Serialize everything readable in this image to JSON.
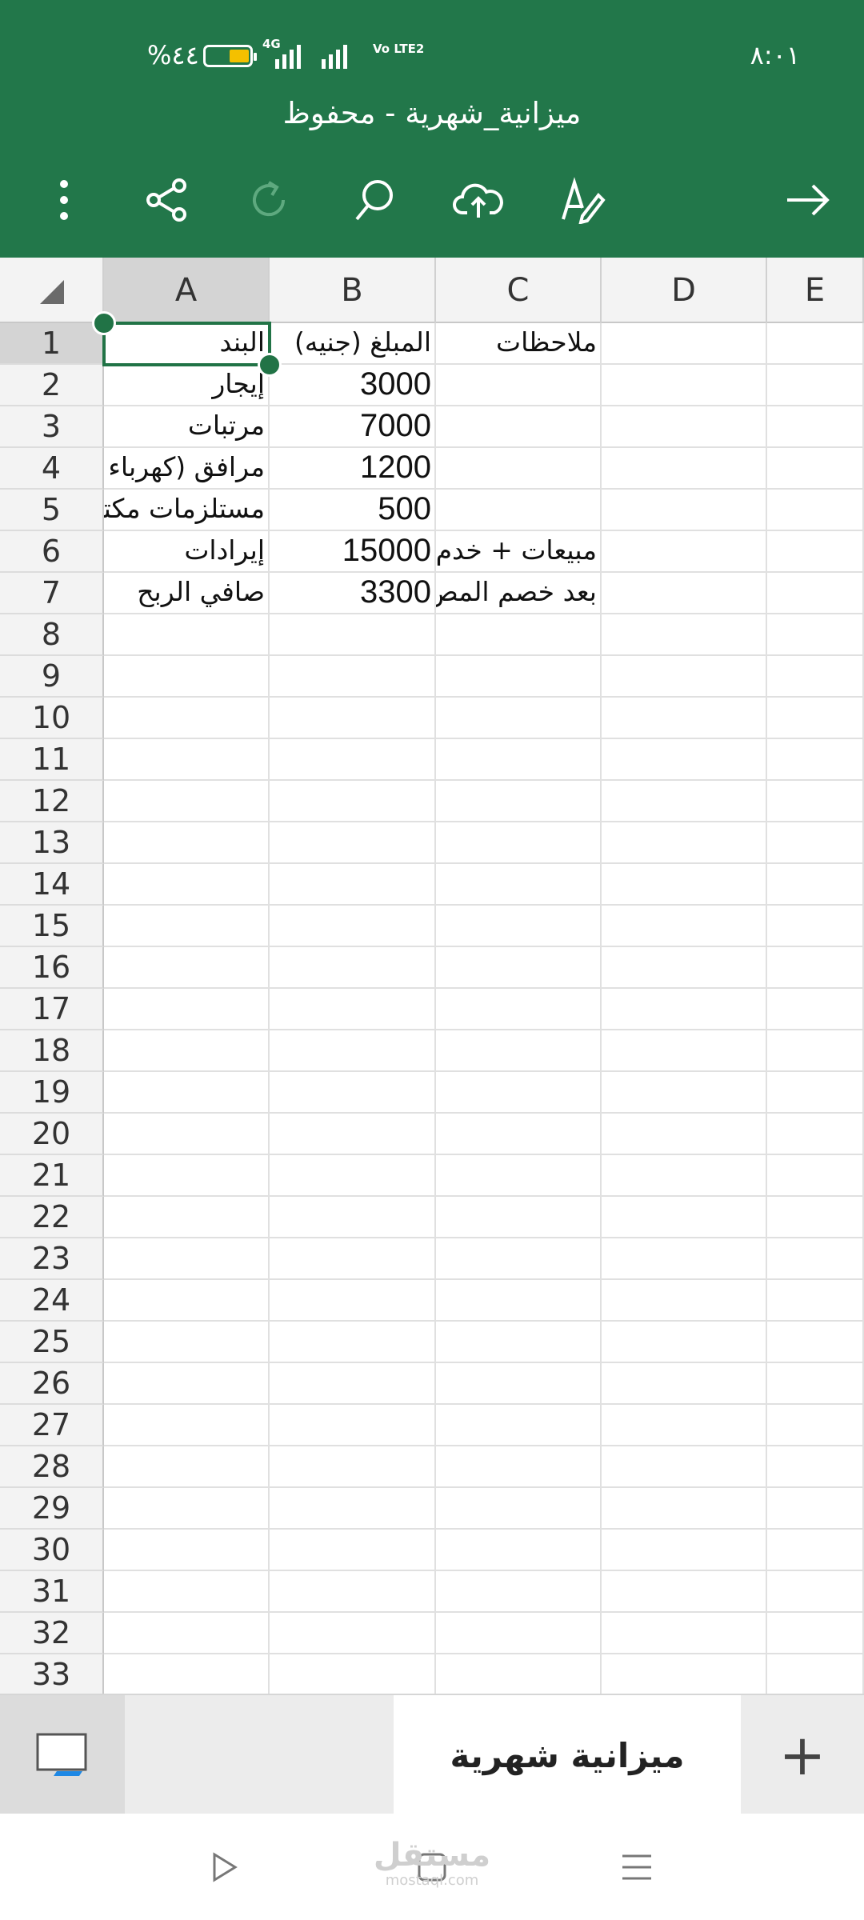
{
  "status_bar": {
    "battery_percent": "%٤٤",
    "network": "4G",
    "volte": "Vo LTE2",
    "time": "٨:٠١"
  },
  "document": {
    "title": "ميزانية_شهرية - محفوظ"
  },
  "toolbar": {
    "icons": [
      "more-icon",
      "share-icon",
      "redo-icon",
      "search-icon",
      "cloud-upload-icon",
      "draw-icon",
      "forward-arrow-icon"
    ]
  },
  "sheet": {
    "column_headers": [
      "A",
      "B",
      "C",
      "D",
      "E"
    ],
    "selected_column": "A",
    "selected_row": "1",
    "row_numbers": [
      "1",
      "2",
      "3",
      "4",
      "5",
      "6",
      "7",
      "8",
      "9",
      "10",
      "11",
      "12",
      "13",
      "14",
      "15",
      "16",
      "17",
      "18",
      "19",
      "20",
      "21",
      "22",
      "23",
      "24",
      "25",
      "26",
      "27",
      "28",
      "29",
      "30",
      "31",
      "32",
      "33"
    ],
    "rows": [
      {
        "A": "البند",
        "B": "المبلغ (جنيه)",
        "C": "ملاحظات"
      },
      {
        "A": "إيجار",
        "B": "3000",
        "C": ""
      },
      {
        "A": "مرتبات",
        "B": "7000",
        "C": ""
      },
      {
        "A": "مرافق (كهرباء",
        "B": "1200",
        "C": ""
      },
      {
        "A": "مستلزمات مكتب",
        "B": "500",
        "C": ""
      },
      {
        "A": "إيرادات",
        "B": "15000",
        "C": "مبيعات + خدم"
      },
      {
        "A": "صافي الربح",
        "B": "3300",
        "C": "بعد خصم المص"
      }
    ]
  },
  "tabs": {
    "active_sheet": "ميزانية شهرية",
    "add_label": "+"
  },
  "watermark": {
    "arabic": "مستقل",
    "latin": "mostaql.com"
  },
  "colors": {
    "brand_green": "#22774a",
    "selection_green": "#217346",
    "battery_yellow": "#f4c000"
  }
}
